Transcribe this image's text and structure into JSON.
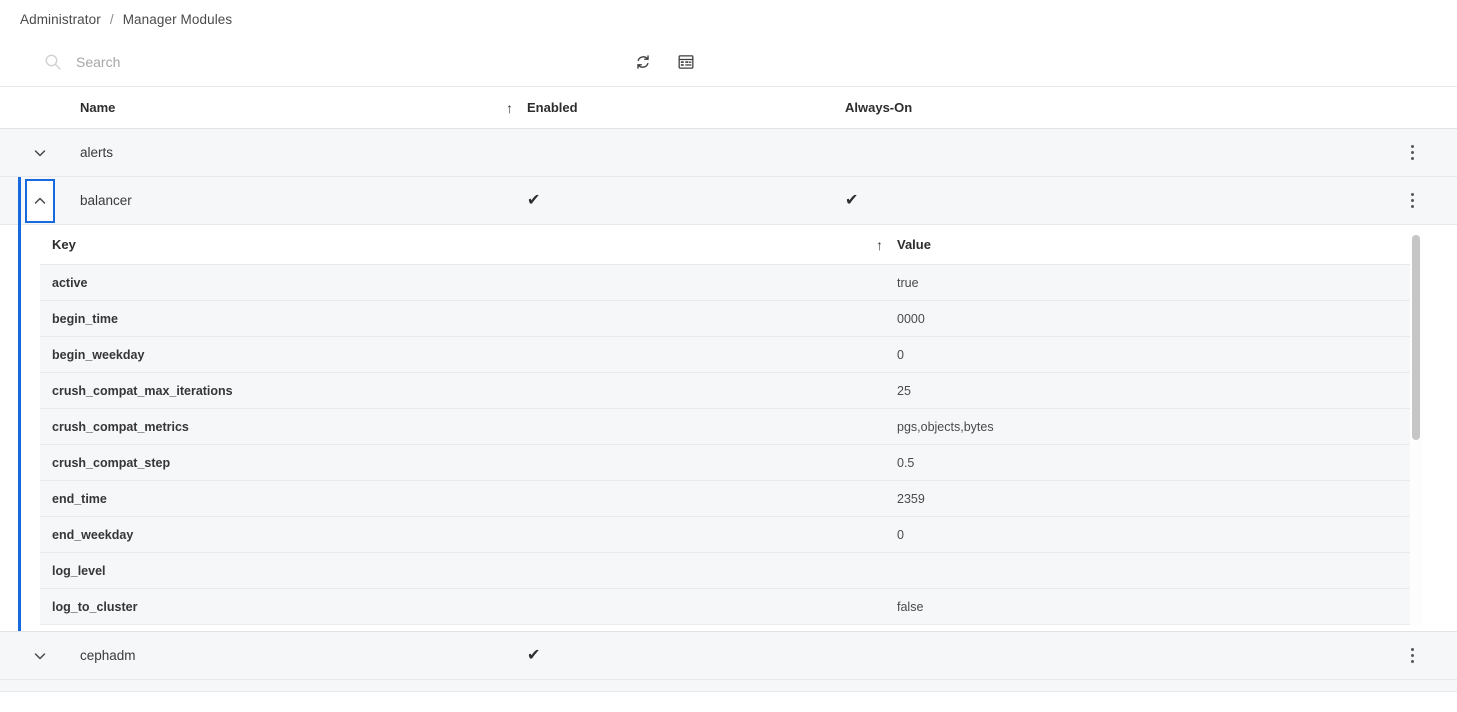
{
  "breadcrumb": {
    "root": "Administrator",
    "separator": "/",
    "current": "Manager Modules"
  },
  "toolbar": {
    "search_placeholder": "Search",
    "search_value": "",
    "refresh_label": "refresh-icon",
    "columns_label": "table-columns-icon"
  },
  "table": {
    "headers": {
      "name": "Name",
      "enabled": "Enabled",
      "always_on": "Always-On",
      "sort_arrow": "↑"
    },
    "rows": [
      {
        "name": "alerts",
        "enabled": "",
        "always_on": "",
        "expanded": false,
        "chevron": "down"
      },
      {
        "name": "balancer",
        "enabled": "✔",
        "always_on": "✔",
        "expanded": true,
        "chevron": "up"
      },
      {
        "name": "cephadm",
        "enabled": "✔",
        "always_on": "",
        "expanded": false,
        "chevron": "down"
      }
    ]
  },
  "detail": {
    "headers": {
      "key": "Key",
      "value": "Value",
      "sort_arrow": "↑"
    },
    "rows": [
      {
        "key": "active",
        "value": "true"
      },
      {
        "key": "begin_time",
        "value": "0000"
      },
      {
        "key": "begin_weekday",
        "value": "0"
      },
      {
        "key": "crush_compat_max_iterations",
        "value": "25"
      },
      {
        "key": "crush_compat_metrics",
        "value": "pgs,objects,bytes"
      },
      {
        "key": "crush_compat_step",
        "value": "0.5"
      },
      {
        "key": "end_time",
        "value": "2359"
      },
      {
        "key": "end_weekday",
        "value": "0"
      },
      {
        "key": "log_level",
        "value": ""
      },
      {
        "key": "log_to_cluster",
        "value": "false"
      }
    ]
  },
  "colors": {
    "accent": "#1769e0",
    "row_bg": "#f6f7f8",
    "border": "#e7e9eb",
    "text": "#3b3b3b",
    "muted": "#a6a6a6"
  }
}
